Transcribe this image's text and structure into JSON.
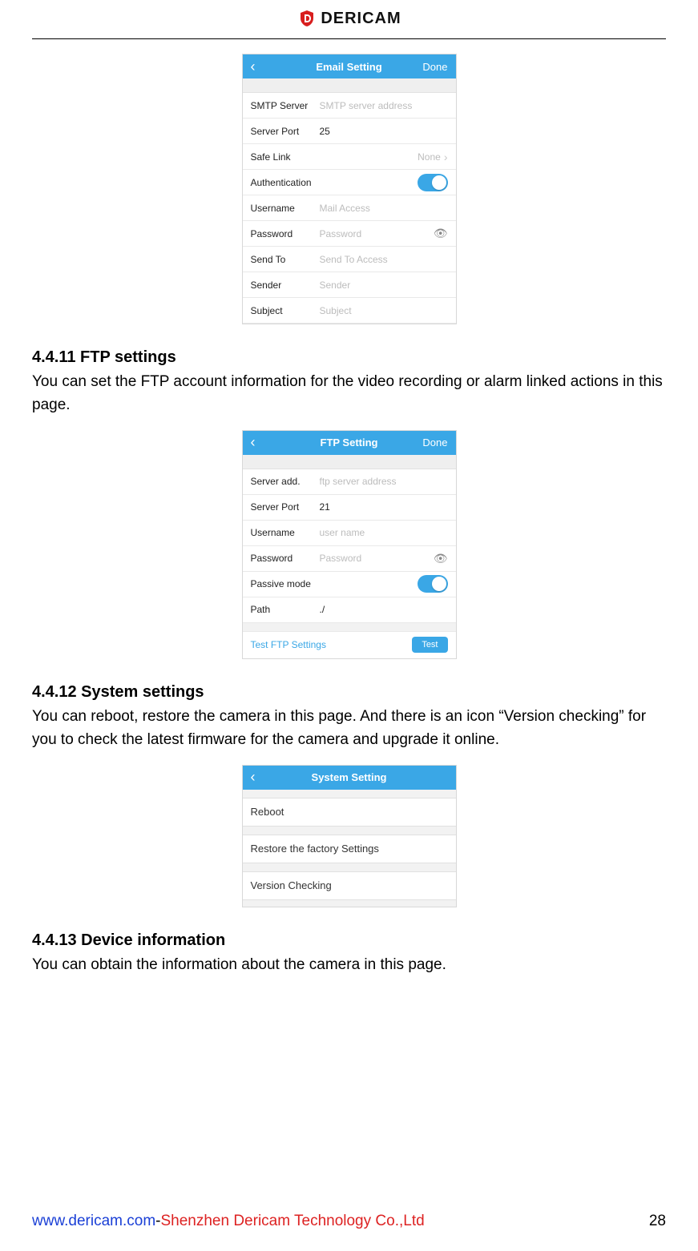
{
  "brand": {
    "name": "DERICAM"
  },
  "email_setting": {
    "title": "Email Setting",
    "done": "Done",
    "rows": {
      "smtp_server": {
        "label": "SMTP Server",
        "placeholder": "SMTP server address"
      },
      "server_port": {
        "label": "Server Port",
        "value": "25"
      },
      "safe_link": {
        "label": "Safe Link",
        "value": "None"
      },
      "authentication": {
        "label": "Authentication"
      },
      "username": {
        "label": "Username",
        "placeholder": "Mail Access"
      },
      "password": {
        "label": "Password",
        "placeholder": "Password"
      },
      "send_to": {
        "label": "Send To",
        "placeholder": "Send To Access"
      },
      "sender": {
        "label": "Sender",
        "placeholder": "Sender"
      },
      "subject": {
        "label": "Subject",
        "placeholder": "Subject"
      }
    }
  },
  "sections": {
    "ftp": {
      "heading": "4.4.11 FTP settings",
      "body": "You can set the FTP account information for the video recording or alarm linked actions in this page."
    },
    "system": {
      "heading": "4.4.12 System settings",
      "body": "You can reboot, restore the camera in this page. And there is an icon “Version checking” for you to check the latest firmware for the camera and upgrade it online."
    },
    "device_info": {
      "heading": "4.4.13 Device information",
      "body": "You can obtain the information about the camera in this page."
    }
  },
  "ftp_setting": {
    "title": "FTP Setting",
    "done": "Done",
    "rows": {
      "server_add": {
        "label": "Server add.",
        "placeholder": "ftp server address"
      },
      "server_port": {
        "label": "Server Port",
        "value": "21"
      },
      "username": {
        "label": "Username",
        "placeholder": "user name"
      },
      "password": {
        "label": "Password",
        "placeholder": "Password"
      },
      "passive_mode": {
        "label": "Passive mode"
      },
      "path": {
        "label": "Path",
        "value": "./"
      }
    },
    "test": {
      "label": "Test FTP Settings",
      "button": "Test"
    }
  },
  "system_setting": {
    "title": "System Setting",
    "items": {
      "reboot": "Reboot",
      "restore": "Restore the factory Settings",
      "version": "Version Checking"
    }
  },
  "footer": {
    "url": "www.dericam.com",
    "dash": "-",
    "company": "Shenzhen Dericam Technology Co.,Ltd",
    "page": "28"
  }
}
